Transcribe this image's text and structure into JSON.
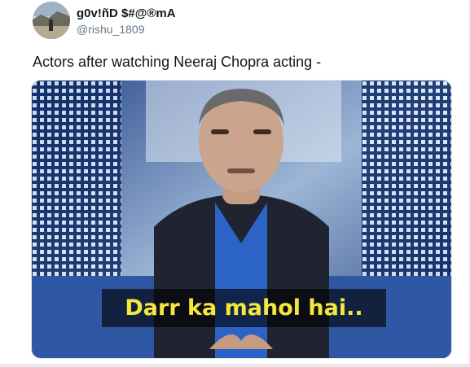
{
  "tweet": {
    "display_name": "g0v!ñD $#@®mA",
    "handle": "@rishu_1809",
    "text": "Actors after watching Neeraj Chopra acting -",
    "media": {
      "caption": "Darr ka mahol hai.."
    }
  },
  "colors": {
    "caption_text": "#f4e83c",
    "name_text": "#14171a",
    "handle_text": "#657786"
  }
}
